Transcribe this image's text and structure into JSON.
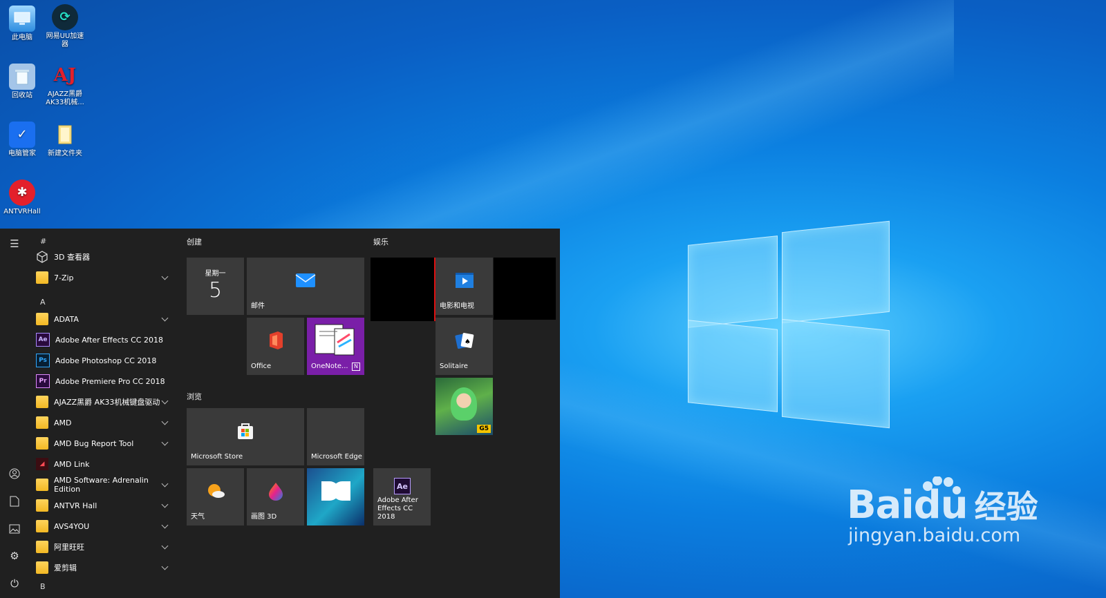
{
  "desktop": {
    "icons": [
      {
        "label": "此电脑"
      },
      {
        "label": "网易UU加速器"
      },
      {
        "label": "回收站"
      },
      {
        "label": "AJAZZ黑爵AK33机械..."
      },
      {
        "label": "电脑管家"
      },
      {
        "label": "新建文件夹"
      },
      {
        "label": "ANTVRHall"
      }
    ]
  },
  "start_menu": {
    "list": {
      "section_hash": "#",
      "section_a": "A",
      "section_b": "B",
      "items": [
        {
          "label": "3D 查看器"
        },
        {
          "label": "7-Zip"
        },
        {
          "label": "ADATA"
        },
        {
          "label": "Adobe After Effects CC 2018",
          "badge": "Ae"
        },
        {
          "label": "Adobe Photoshop CC 2018",
          "badge": "Ps"
        },
        {
          "label": "Adobe Premiere Pro CC 2018",
          "badge": "Pr"
        },
        {
          "label": "AJAZZ黑爵 AK33机械键盘驱动"
        },
        {
          "label": "AMD"
        },
        {
          "label": "AMD Bug Report Tool"
        },
        {
          "label": "AMD Link"
        },
        {
          "label": "AMD Software: Adrenalin Edition"
        },
        {
          "label": "ANTVR Hall"
        },
        {
          "label": "AVS4YOU"
        },
        {
          "label": "阿里旺旺"
        },
        {
          "label": "爱剪辑"
        }
      ]
    },
    "groups": {
      "create": "创建",
      "entertainment": "娱乐",
      "browse": "浏览"
    },
    "tiles": {
      "calendar_day": "星期一",
      "calendar_date": "5",
      "mail": "邮件",
      "office": "Office",
      "onenote": "OneNote...",
      "movies": "电影和电视",
      "solitaire": "Solitaire",
      "store": "Microsoft Store",
      "edge": "Microsoft Edge",
      "weather": "天气",
      "paint3d": "画图 3D",
      "ae": "Adobe After Effects CC 2018",
      "ae_badge": "Ae",
      "g5_badge": "G5"
    }
  },
  "watermark": {
    "brand": "Baidu",
    "suffix": "经验",
    "url": "jingyan.baidu.com"
  },
  "colors": {
    "start_bg": "#202020",
    "tile_bg": "#3a3a3a",
    "onenote_purple": "#7a1fa8",
    "folder_yellow": "#f2b824"
  }
}
